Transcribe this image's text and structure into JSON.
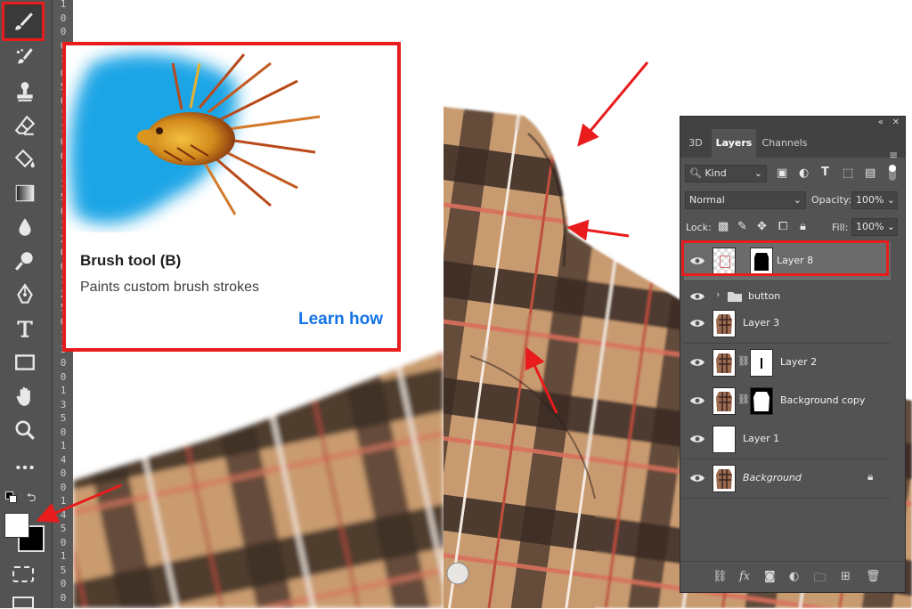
{
  "toolbar": {
    "tools": [
      "brush-tool",
      "mixer-brush-tool",
      "clone-stamp-tool",
      "eraser-tool",
      "paint-bucket-tool",
      "gradient-tool",
      "blur-tool",
      "dodge-tool",
      "pen-tool",
      "type-tool",
      "rectangle-tool",
      "hand-tool",
      "zoom-tool",
      "more-tools"
    ]
  },
  "ruler": {
    "digits": [
      "1",
      "0",
      "0",
      "0",
      "1",
      "0",
      "5",
      "0",
      "1",
      "1",
      "0",
      "0",
      "1",
      "1",
      "5",
      "0",
      "1",
      "2",
      "0",
      "0",
      "1",
      "2",
      "5",
      "0",
      "1",
      "3",
      "0",
      "0",
      "1",
      "3",
      "5",
      "0",
      "1",
      "4",
      "0",
      "0",
      "1",
      "4",
      "5",
      "0",
      "1",
      "5",
      "0",
      "0"
    ]
  },
  "tooltip": {
    "title": "Brush tool (B)",
    "description": "Paints custom brush strokes",
    "link": "Learn how"
  },
  "layers_panel": {
    "tabs": [
      "3D",
      "Layers",
      "Channels"
    ],
    "active_tab": "Layers",
    "filter_kind": "Kind",
    "blend_mode": "Normal",
    "opacity_label": "Opacity:",
    "opacity_value": "100%",
    "lock_label": "Lock:",
    "fill_label": "Fill:",
    "fill_value": "100%",
    "layers": [
      {
        "name": "Layer 8",
        "selected": true
      },
      {
        "name": "button",
        "group": true
      },
      {
        "name": "Layer 3"
      },
      {
        "name": "Layer 2"
      },
      {
        "name": "Background copy"
      },
      {
        "name": "Layer 1"
      },
      {
        "name": "Background",
        "locked": true
      }
    ]
  },
  "colors": {
    "highlight": "#e81c1c",
    "link": "#1473e6",
    "panel_bg": "#535353",
    "toolbar_bg": "#535353",
    "fabric_tan": "#c89a70",
    "fabric_dark": "#3a2a24"
  }
}
